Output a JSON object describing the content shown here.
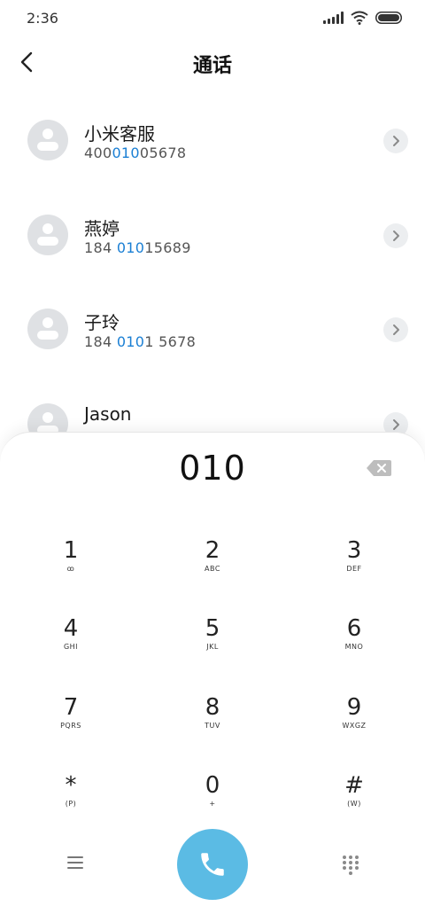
{
  "status_bar": {
    "time": "2:36"
  },
  "header": {
    "title": "通话"
  },
  "contacts": [
    {
      "name": "小米客服",
      "number_pre": "400",
      "number_hl": "010",
      "number_post": "05678"
    },
    {
      "name": "燕婷",
      "number_pre": "184 ",
      "number_hl": "010",
      "number_post": "15689"
    },
    {
      "name": "子玲",
      "number_pre": "184 ",
      "number_hl": "010",
      "number_post": "1 5678"
    },
    {
      "name": "Jason",
      "number_pre": "",
      "number_hl": "",
      "number_post": ""
    }
  ],
  "dialpad": {
    "input": "010",
    "keys": [
      {
        "digit": "1",
        "letters": "ꝏ"
      },
      {
        "digit": "2",
        "letters": "ABC"
      },
      {
        "digit": "3",
        "letters": "DEF"
      },
      {
        "digit": "4",
        "letters": "GHI"
      },
      {
        "digit": "5",
        "letters": "JKL"
      },
      {
        "digit": "6",
        "letters": "MNO"
      },
      {
        "digit": "7",
        "letters": "PQRS"
      },
      {
        "digit": "8",
        "letters": "TUV"
      },
      {
        "digit": "9",
        "letters": "WXGZ"
      },
      {
        "digit": "*",
        "letters": "(P)"
      },
      {
        "digit": "0",
        "letters": "+"
      },
      {
        "digit": "#",
        "letters": "(W)"
      }
    ]
  },
  "colors": {
    "accent_blue": "#1a7fd4",
    "call_button": "#5bbbe4",
    "avatar_bg": "#dfe1e4"
  },
  "icons": {
    "back": "chevron-left-icon",
    "detail": "chevron-right-icon",
    "backspace": "backspace-icon",
    "menu": "menu-icon",
    "call": "phone-icon",
    "keypad": "dialpad-icon"
  }
}
